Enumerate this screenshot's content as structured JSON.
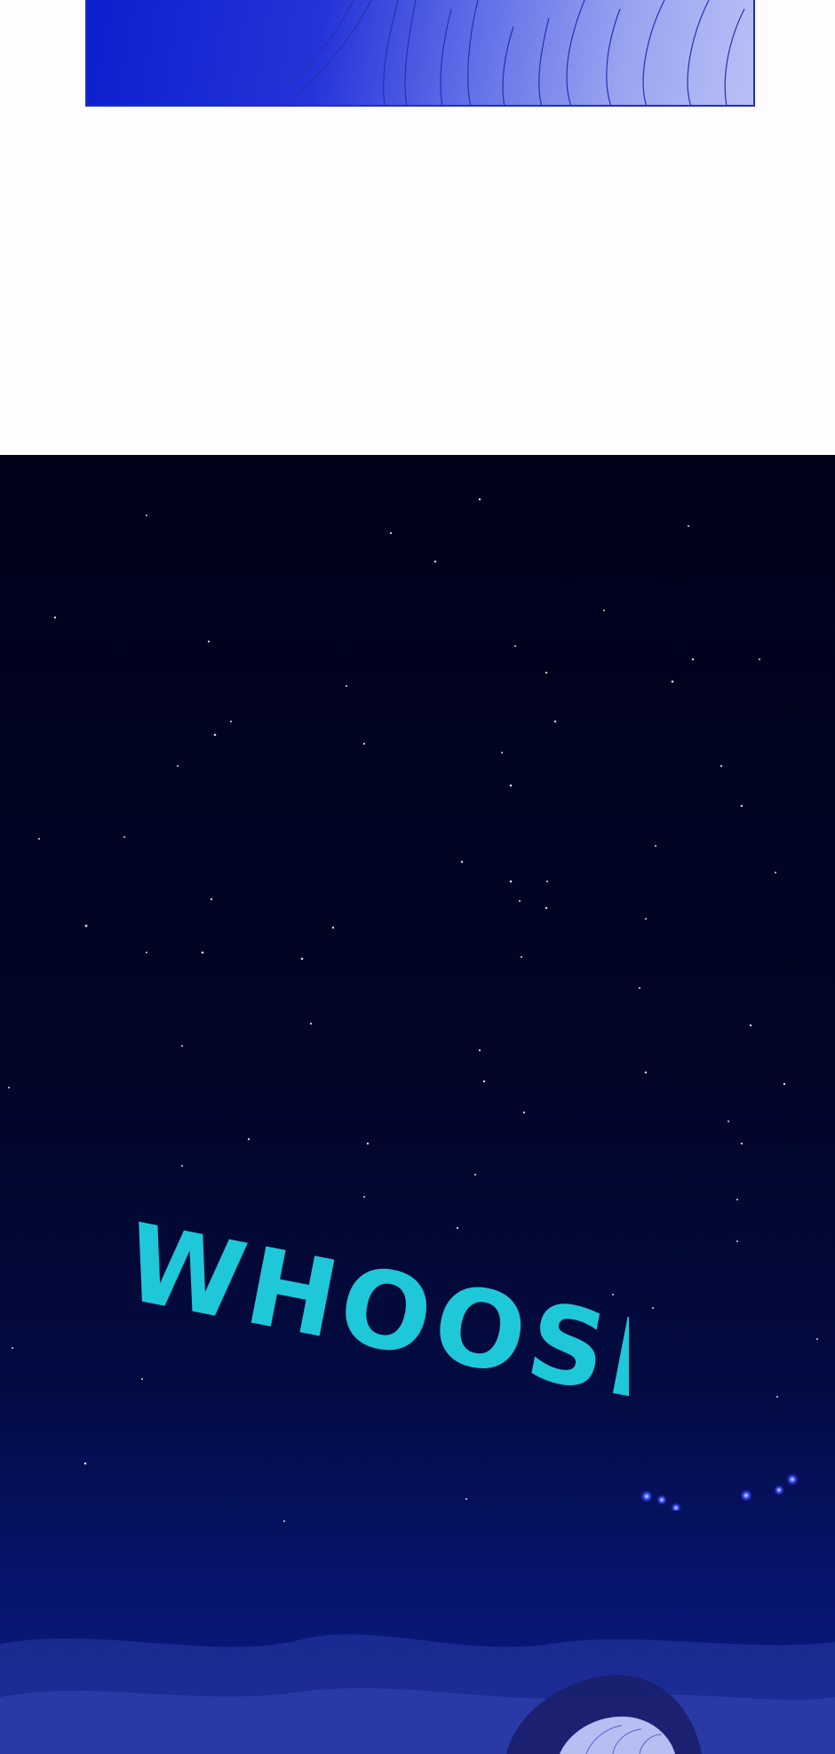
{
  "sound_effect": {
    "text": "WHOOSH",
    "color": "#1fc8d8"
  },
  "colors": {
    "top_panel_blue": "#0b1fcf",
    "night_sky": "#00021a",
    "horizon_blue": "#0b1c8a",
    "star": "#ffffff",
    "glow_light": "#4a5cff"
  }
}
